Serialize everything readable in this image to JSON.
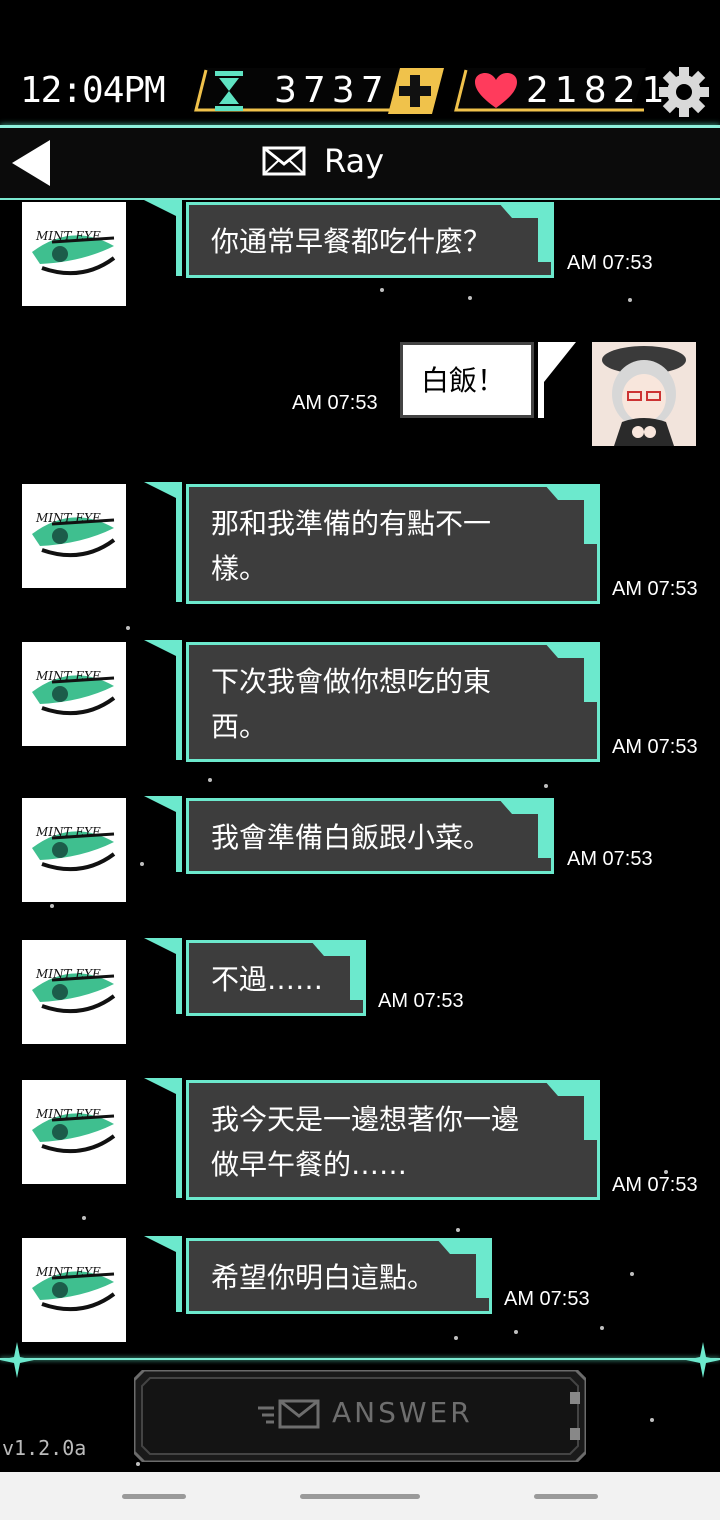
{
  "status": {
    "time": "12:04PM"
  },
  "resources": {
    "hourglass": "3737",
    "hearts": "21821"
  },
  "header": {
    "title": "Ray"
  },
  "messages": [
    {
      "text": "你通常早餐都吃什麼？",
      "time": "AM 07:53",
      "sender": "mint-eye"
    },
    {
      "text": "白飯！",
      "time": "AM 07:53",
      "sender": "user"
    },
    {
      "text": "那和我準備的有點不一樣。",
      "line1": "那和我準備的有點不一",
      "line2": "樣。",
      "time": "AM 07:53",
      "sender": "mint-eye"
    },
    {
      "text": "下次我會做你想吃的東西。",
      "line1": "下次我會做你想吃的東",
      "line2": "西。",
      "time": "AM 07:53",
      "sender": "mint-eye"
    },
    {
      "text": "我會準備白飯跟小菜。",
      "time": "AM 07:53",
      "sender": "mint-eye"
    },
    {
      "text": "不過……",
      "time": "AM 07:53",
      "sender": "mint-eye"
    },
    {
      "text": "我今天是一邊想著你一邊做早午餐的……",
      "line1": "我今天是一邊想著你一邊",
      "line2": "做早午餐的……",
      "time": "AM 07:53",
      "sender": "mint-eye"
    },
    {
      "text": "希望你明白這點。",
      "time": "AM 07:53",
      "sender": "mint-eye"
    }
  ],
  "answer": {
    "label": "ANSWER"
  },
  "version": "v1.2.0a",
  "colors": {
    "accent": "#6ce9cd",
    "bubble": "#3d3d3d",
    "gold": "#f0c24b",
    "heart": "#ff3b5c"
  }
}
